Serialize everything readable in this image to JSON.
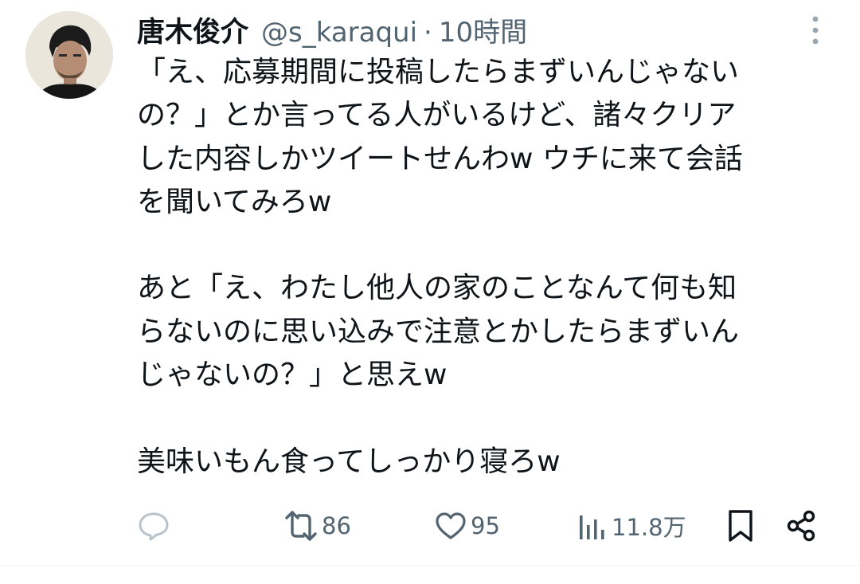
{
  "tweet": {
    "author": {
      "display_name": "唐木俊介",
      "handle": "@s_karaqui",
      "separator": "·",
      "time": "10時間"
    },
    "body": {
      "p1": [
        "「え、応募期間に投稿したらまずいんじゃない",
        "の？」とか言ってる人がいるけど、諸々クリア",
        "した内容しかツイートせんわw ウチに来て会話",
        "を聞いてみろw"
      ],
      "p2": [
        "あと「え、わたし他人の家のことなんて何も知",
        "らないのに思い込みで注意とかしたらまずいん",
        "じゃないの？」と思えw"
      ],
      "p3": [
        "美味いもん食ってしっかり寝ろw"
      ]
    },
    "actions": {
      "reply_icon": "reply-icon",
      "retweet_count": "86",
      "like_count": "95",
      "views_count": "11.8万"
    }
  },
  "colors": {
    "text": "#0f1419",
    "secondary": "#536471",
    "divider": "#eff3f4"
  }
}
